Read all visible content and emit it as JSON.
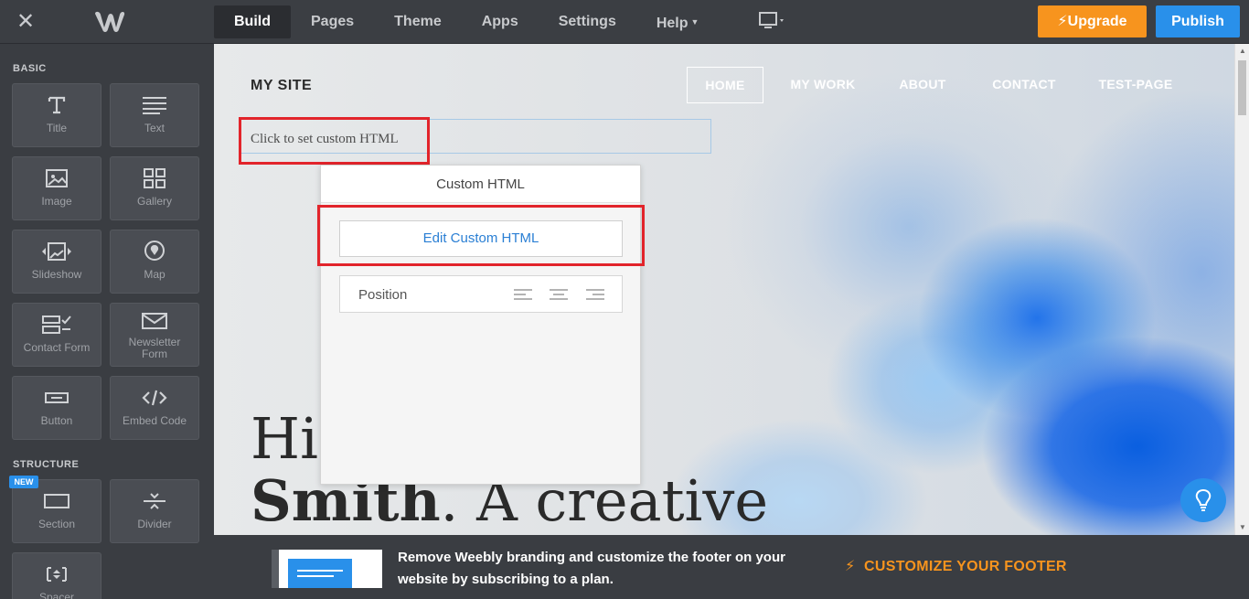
{
  "topbar": {
    "nav": [
      "Build",
      "Pages",
      "Theme",
      "Apps",
      "Settings",
      "Help"
    ],
    "upgrade_label": "Upgrade",
    "publish_label": "Publish"
  },
  "sidebar": {
    "basic_label": "BASIC",
    "structure_label": "STRUCTURE",
    "new_badge": "NEW",
    "tiles": {
      "title": "Title",
      "text": "Text",
      "image": "Image",
      "gallery": "Gallery",
      "slideshow": "Slideshow",
      "map": "Map",
      "contact_form": "Contact Form",
      "newsletter_1": "Newsletter",
      "newsletter_2": "Form",
      "button": "Button",
      "embed_code": "Embed Code",
      "section": "Section",
      "divider": "Divider",
      "spacer": "Spacer"
    }
  },
  "site": {
    "title": "MY SITE",
    "nav": [
      "HOME",
      "MY WORK",
      "ABOUT",
      "CONTACT",
      "TEST-PAGE"
    ],
    "custom_html_placeholder": "Click to set custom HTML",
    "hero_line1": "Hi",
    "hero_line2_bold": "Smith",
    "hero_line2_rest": ". A creative"
  },
  "popup": {
    "title": "Custom HTML",
    "edit_label": "Edit Custom HTML",
    "position_label": "Position"
  },
  "footer": {
    "message": "Remove Weebly branding and customize the footer on your website by subscribing to a plan.",
    "cta": "CUSTOMIZE YOUR FOOTER"
  },
  "colors": {
    "upgrade": "#f7941e",
    "publish": "#2990ea",
    "highlight": "#e2242b"
  }
}
